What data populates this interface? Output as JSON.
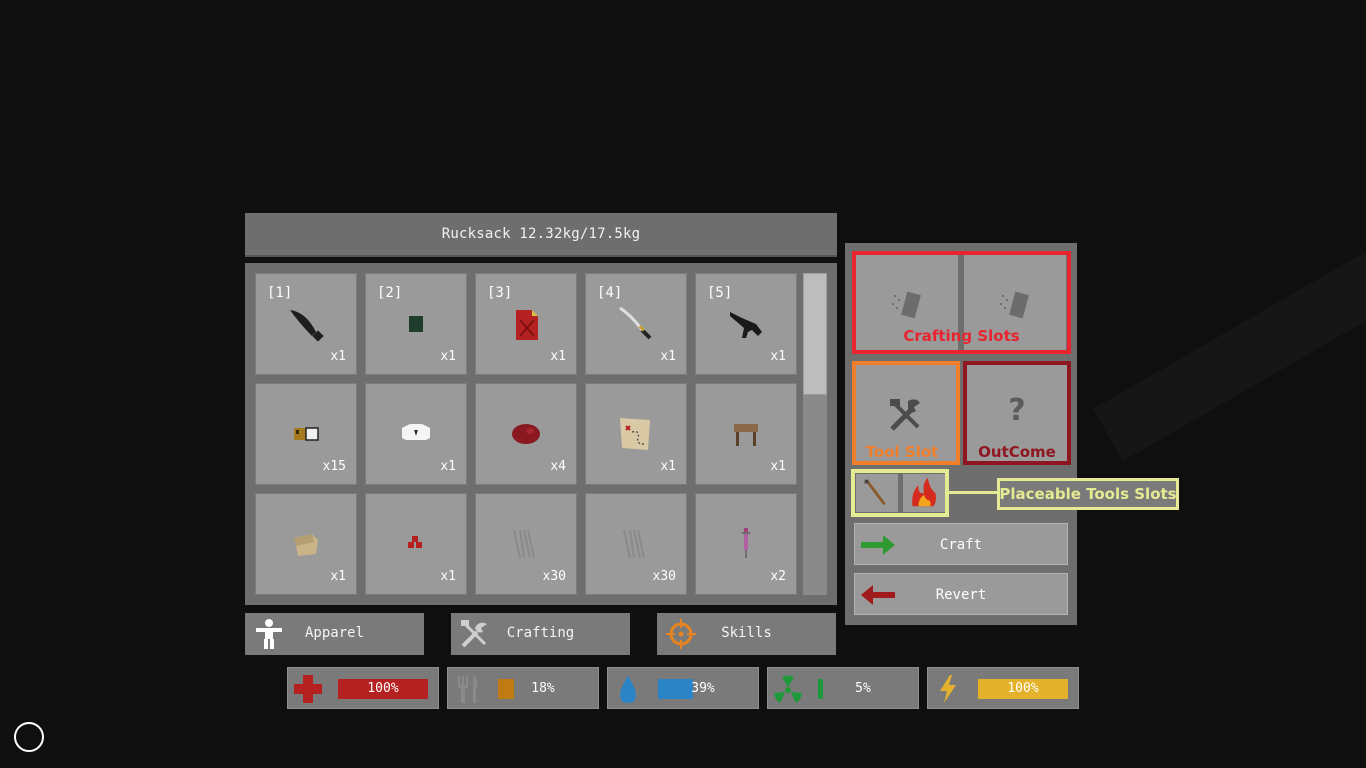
{
  "inventory": {
    "title": "Rucksack 12.32kg/17.5kg",
    "slots": [
      {
        "hotkey": "[1]",
        "qty": "x1",
        "icon": "machete-icon"
      },
      {
        "hotkey": "[2]",
        "qty": "x1",
        "icon": "dark-green-box-icon"
      },
      {
        "hotkey": "[3]",
        "qty": "x1",
        "icon": "red-map-icon"
      },
      {
        "hotkey": "[4]",
        "qty": "x1",
        "icon": "katana-icon"
      },
      {
        "hotkey": "[5]",
        "qty": "x1",
        "icon": "rifle-icon"
      },
      {
        "hotkey": "",
        "qty": "x15",
        "icon": "ammo-box-icon"
      },
      {
        "hotkey": "",
        "qty": "x1",
        "icon": "white-shirt-icon"
      },
      {
        "hotkey": "",
        "qty": "x4",
        "icon": "raw-meat-icon"
      },
      {
        "hotkey": "",
        "qty": "x1",
        "icon": "treasure-map-icon"
      },
      {
        "hotkey": "",
        "qty": "x1",
        "icon": "wooden-stool-icon"
      },
      {
        "hotkey": "",
        "qty": "x1",
        "icon": "cloth-scrap-icon"
      },
      {
        "hotkey": "",
        "qty": "x1",
        "icon": "red-berries-icon"
      },
      {
        "hotkey": "",
        "qty": "x30",
        "icon": "sticks-icon"
      },
      {
        "hotkey": "",
        "qty": "x30",
        "icon": "sticks-icon"
      },
      {
        "hotkey": "",
        "qty": "x2",
        "icon": "syringe-icon"
      }
    ]
  },
  "tabs": [
    {
      "label": "Apparel",
      "icon": "person-icon"
    },
    {
      "label": "Crafting",
      "icon": "tools-icon"
    },
    {
      "label": "Skills",
      "icon": "crosshair-icon"
    }
  ],
  "crafting": {
    "crafting_slots_label": "Crafting Slots",
    "tool_slot_label": "Tool Slot",
    "outcome_label": "OutCome",
    "outcome_symbol": "?",
    "placeable_label": "Placeable Tools Slots",
    "craft_label": "Craft",
    "revert_label": "Revert"
  },
  "stats": [
    {
      "name": "health",
      "value": "100%",
      "fill": 1.0,
      "color": "#b52121",
      "icon": "health-cross-icon"
    },
    {
      "name": "food",
      "value": "18%",
      "fill": 0.18,
      "color": "#c07a14",
      "icon": "fork-knife-icon"
    },
    {
      "name": "water",
      "value": "39%",
      "fill": 0.39,
      "color": "#2a84c6",
      "icon": "water-drop-icon"
    },
    {
      "name": "radiation",
      "value": "5%",
      "fill": 0.05,
      "color": "#1f9a3a",
      "icon": "radiation-icon"
    },
    {
      "name": "energy",
      "value": "100%",
      "fill": 1.0,
      "color": "#e3b22a",
      "icon": "lightning-icon"
    }
  ],
  "colors": {
    "crafting_highlight": "#e8242e",
    "tool_highlight": "#f07f2c",
    "outcome_highlight": "#8e1620",
    "placeable_highlight": "#e5eb92"
  }
}
